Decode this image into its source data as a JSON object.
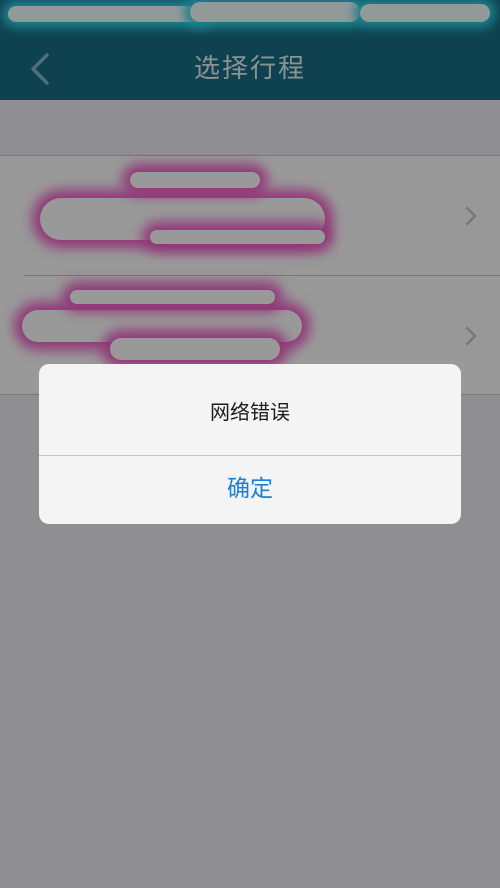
{
  "nav": {
    "title": "选择行程",
    "back_icon": "chevron-left-icon"
  },
  "list": {
    "items": [
      {
        "label": "",
        "icon": "chevron-right-icon"
      },
      {
        "label": "",
        "icon": "chevron-right-icon"
      }
    ]
  },
  "alert": {
    "message": "网络错误",
    "confirm_label": "确定"
  },
  "colors": {
    "nav_background": "#1a6f86",
    "nav_title": "#e7f4f7",
    "confirm_text": "#1a7fd6",
    "list_background": "#ffffff",
    "page_background": "#efeff4"
  }
}
